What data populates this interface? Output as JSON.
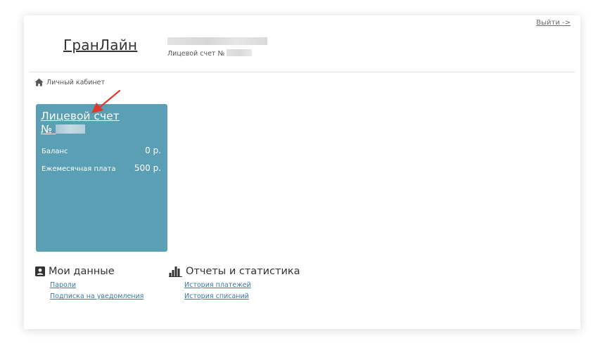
{
  "header": {
    "logout_label": "Выйти ->",
    "brand": "ГранЛайн",
    "account_label": "Лицевой счет №"
  },
  "breadcrumb": {
    "label": "Личный кабинет"
  },
  "account_card": {
    "title_line1": "Лицевой счет",
    "title_line2": "№",
    "rows": [
      {
        "label": "Баланс",
        "value": "0 р."
      },
      {
        "label": "Ежемесячная плата",
        "value": "500 р."
      }
    ]
  },
  "sections": {
    "my_data": {
      "title": "Мои данные",
      "links": [
        "Пароли",
        "Подписка на уведомления"
      ]
    },
    "reports": {
      "title": "Отчеты и статистика",
      "links": [
        "История платежей",
        "История списаний"
      ]
    }
  },
  "colors": {
    "card_bg": "#5a9fb3",
    "link": "#3a78a3",
    "arrow": "#e03a2f"
  },
  "icons": {
    "breadcrumb": "home-icon",
    "my_data": "contact-card-icon",
    "reports": "bar-chart-icon"
  }
}
